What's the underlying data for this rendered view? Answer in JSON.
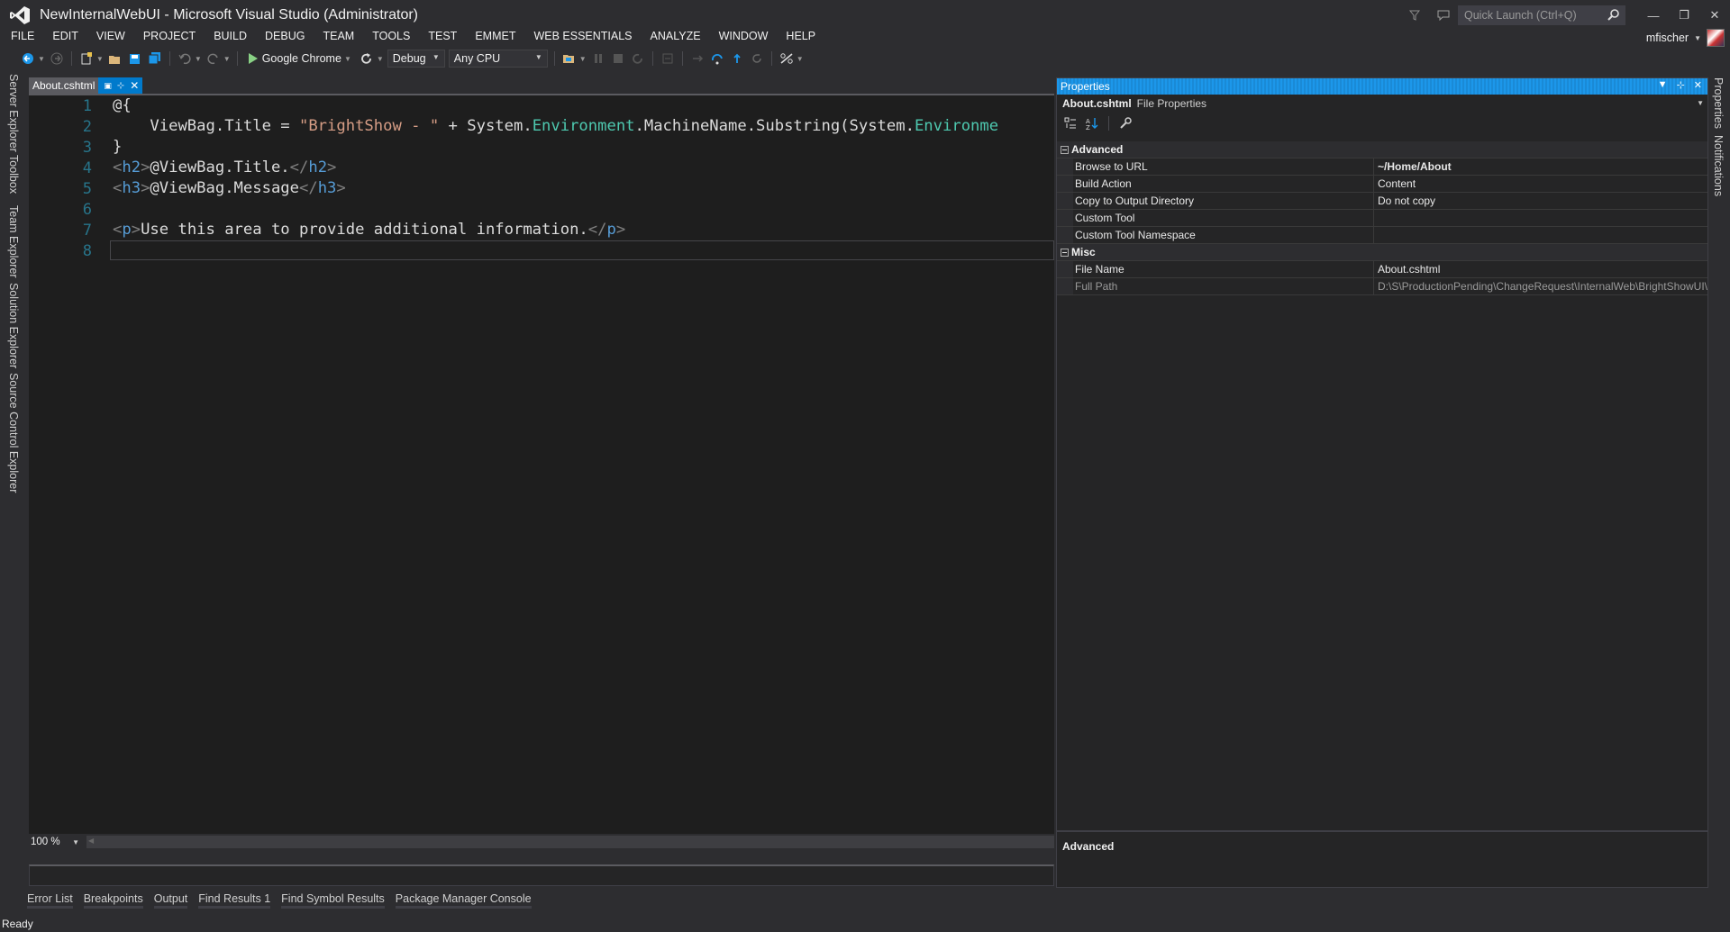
{
  "window": {
    "title": "NewInternalWebUI - Microsoft Visual Studio (Administrator)",
    "quick_launch_placeholder": "Quick Launch (Ctrl+Q)",
    "user": "mfischer"
  },
  "menu": [
    "FILE",
    "EDIT",
    "VIEW",
    "PROJECT",
    "BUILD",
    "DEBUG",
    "TEAM",
    "TOOLS",
    "TEST",
    "EMMET",
    "WEB ESSENTIALS",
    "ANALYZE",
    "WINDOW",
    "HELP"
  ],
  "toolbar": {
    "run_target": "Google Chrome",
    "configuration": "Debug",
    "platform": "Any CPU"
  },
  "left_tabs": [
    "Server Explorer",
    "Toolbox",
    "Team Explorer",
    "Solution Explorer",
    "Source Control Explorer"
  ],
  "right_tabs": [
    "Properties",
    "Notifications"
  ],
  "editor": {
    "tab_name": "About.cshtml",
    "zoom": "100 %",
    "line_numbers": [
      "1",
      "2",
      "3",
      "4",
      "5",
      "6",
      "7",
      "8"
    ],
    "code": {
      "l1": "@{",
      "l2_indent": "    ",
      "l2_a": "ViewBag.Title = ",
      "l2_str": "\"BrightShow - \"",
      "l2_b": " + System.",
      "l2_type1": "Environment",
      "l2_c": ".MachineName.Substring(System.",
      "l2_type2": "Environme",
      "l3": "}",
      "l4_open": "<",
      "l4_tag": "h2",
      "l4_close": ">",
      "l4_text": "@ViewBag.Title.",
      "l4_end_open": "</",
      "l4_end_tag": "h2",
      "l4_end_close": ">",
      "l5_open": "<",
      "l5_tag": "h3",
      "l5_close": ">",
      "l5_text": "@ViewBag.Message",
      "l5_end_open": "</",
      "l5_end_tag": "h3",
      "l5_end_close": ">",
      "l7_open": "<",
      "l7_tag": "p",
      "l7_close": ">",
      "l7_text": "Use this area to provide additional information.",
      "l7_end_open": "</",
      "l7_end_tag": "p",
      "l7_end_close": ">"
    }
  },
  "bottom_tabs": [
    "Error List",
    "Breakpoints",
    "Output",
    "Find Results 1",
    "Find Symbol Results",
    "Package Manager Console"
  ],
  "status": "Ready",
  "properties": {
    "title": "Properties",
    "object_name": "About.cshtml",
    "object_type": "File Properties",
    "categories": [
      {
        "name": "Advanced",
        "rows": [
          {
            "name": "Browse to URL",
            "value": "~/Home/About"
          },
          {
            "name": "Build Action",
            "value": "Content"
          },
          {
            "name": "Copy to Output Directory",
            "value": "Do not copy"
          },
          {
            "name": "Custom Tool",
            "value": ""
          },
          {
            "name": "Custom Tool Namespace",
            "value": ""
          }
        ]
      },
      {
        "name": "Misc",
        "rows": [
          {
            "name": "File Name",
            "value": "About.cshtml"
          },
          {
            "name": "Full Path",
            "value": "D:\\S\\ProductionPending\\ChangeRequest\\InternalWeb\\BrightShowUI\\"
          }
        ]
      }
    ],
    "description_title": "Advanced"
  }
}
